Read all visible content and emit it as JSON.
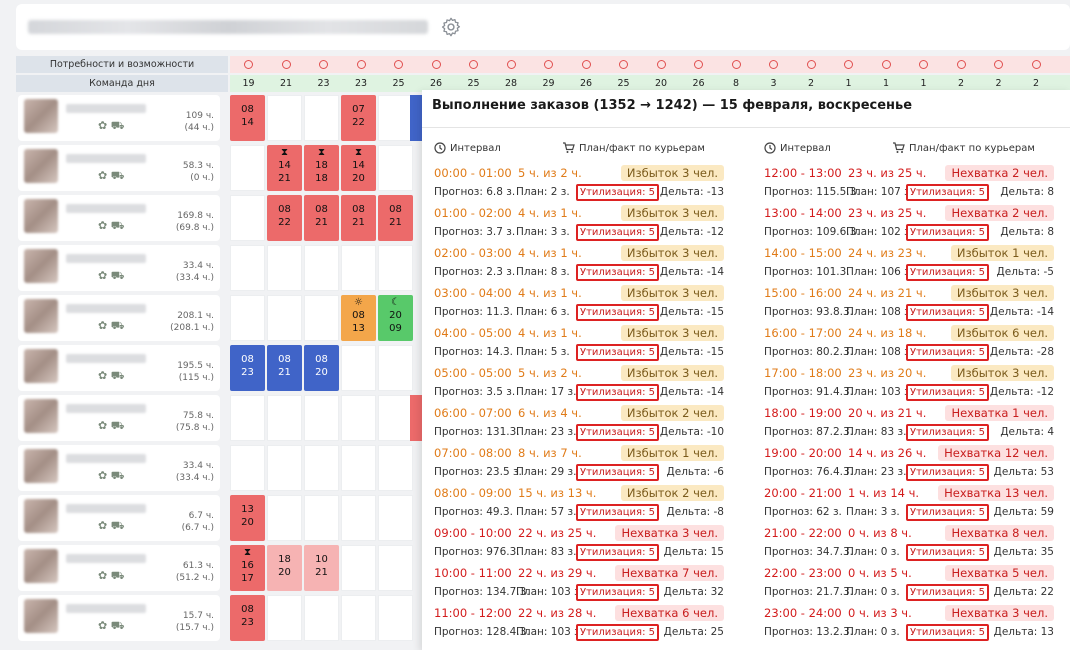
{
  "header": {
    "settings_icon": "gear-icon"
  },
  "grid": {
    "needs_label": "Потребности и возможности",
    "team_label": "Команда дня",
    "day_counts": [
      "19",
      "21",
      "23",
      "23",
      "25",
      "26",
      "25",
      "28",
      "29",
      "26",
      "25",
      "20",
      "26",
      "8",
      "3",
      "2",
      "1",
      "1",
      "1",
      "2",
      "2",
      "2"
    ],
    "hours": [
      {
        "total": "109 ч.",
        "sub": "(44 ч.)"
      },
      {
        "total": "58.3 ч.",
        "sub": "(0 ч.)"
      },
      {
        "total": "169.8 ч.",
        "sub": "(69.8 ч.)"
      },
      {
        "total": "33.4 ч.",
        "sub": "(33.4 ч.)"
      },
      {
        "total": "208.1 ч.",
        "sub": "(208.1 ч.)"
      },
      {
        "total": "195.5 ч.",
        "sub": "(115 ч.)"
      },
      {
        "total": "75.8 ч.",
        "sub": "(75.8 ч.)"
      },
      {
        "total": "33.4 ч.",
        "sub": "(33.4 ч.)"
      },
      {
        "total": "6.7 ч.",
        "sub": "(6.7 ч.)"
      },
      {
        "total": "61.3 ч.",
        "sub": "(51.2 ч.)"
      },
      {
        "total": "15.7 ч.",
        "sub": "(15.7 ч.)"
      }
    ],
    "shifts": [
      [
        {
          "col": 0,
          "a": "08",
          "b": "14",
          "c": "red"
        },
        {
          "col": 3,
          "a": "07",
          "b": "22",
          "c": "red"
        }
      ],
      [
        {
          "col": 1,
          "a": "14",
          "b": "21",
          "c": "red",
          "i": "⧗"
        },
        {
          "col": 2,
          "a": "18",
          "b": "18",
          "c": "red",
          "i": "⧗"
        },
        {
          "col": 3,
          "a": "14",
          "b": "20",
          "c": "red",
          "i": "⧗"
        }
      ],
      [
        {
          "col": 1,
          "a": "08",
          "b": "22",
          "c": "red"
        },
        {
          "col": 2,
          "a": "08",
          "b": "21",
          "c": "red"
        },
        {
          "col": 3,
          "a": "08",
          "b": "21",
          "c": "red"
        },
        {
          "col": 4,
          "a": "08",
          "b": "21",
          "c": "red"
        }
      ],
      [],
      [
        {
          "col": 3,
          "a": "08",
          "b": "13",
          "c": "orange",
          "i": "☼"
        },
        {
          "col": 4,
          "a": "20",
          "b": "09",
          "c": "green",
          "i": "☾"
        }
      ],
      [
        {
          "col": 0,
          "a": "08",
          "b": "23",
          "c": "blue"
        },
        {
          "col": 1,
          "a": "08",
          "b": "21",
          "c": "blue"
        },
        {
          "col": 2,
          "a": "08",
          "b": "20",
          "c": "blue"
        }
      ],
      [],
      [],
      [
        {
          "col": 0,
          "a": "13",
          "b": "20",
          "c": "red"
        }
      ],
      [
        {
          "col": 0,
          "a": "16",
          "b": "17",
          "c": "red",
          "i": "⧗"
        },
        {
          "col": 1,
          "a": "18",
          "b": "20",
          "c": "pink"
        },
        {
          "col": 2,
          "a": "10",
          "b": "21",
          "c": "pink"
        }
      ],
      [
        {
          "col": 0,
          "a": "08",
          "b": "23",
          "c": "red"
        }
      ]
    ]
  },
  "popup": {
    "title": "Выполнение заказов (1352 → 1242) — 15 февраля, воскресенье",
    "interval_label": "Интервал",
    "planfact_label": "План/факт по курьерам",
    "left": [
      {
        "iv": "00:00 - 01:00",
        "hr": "5 ч. из 2 ч.",
        "st": "Избыток 3 чел.",
        "sc": "surplus",
        "fc": "Прогноз: 6.8 з.",
        "pl": "План: 2 з.",
        "ut": "Утилизация: 5",
        "dl": "Дельта: -13"
      },
      {
        "iv": "01:00 - 02:00",
        "hr": "4 ч. из 1 ч.",
        "st": "Избыток 3 чел.",
        "sc": "surplus",
        "fc": "Прогноз: 3.7 з.",
        "pl": "План: 3 з.",
        "ut": "Утилизация: 5",
        "dl": "Дельта: -12"
      },
      {
        "iv": "02:00 - 03:00",
        "hr": "4 ч. из 1 ч.",
        "st": "Избыток 3 чел.",
        "sc": "surplus",
        "fc": "Прогноз: 2.3 з.",
        "pl": "План: 8 з.",
        "ut": "Утилизация: 5",
        "dl": "Дельта: -14"
      },
      {
        "iv": "03:00 - 04:00",
        "hr": "4 ч. из 1 ч.",
        "st": "Избыток 3 чел.",
        "sc": "surplus",
        "fc": "Прогноз: 11.3.",
        "pl": "План: 6 з.",
        "ut": "Утилизация: 5",
        "dl": "Дельта: -15"
      },
      {
        "iv": "04:00 - 05:00",
        "hr": "4 ч. из 1 ч.",
        "st": "Избыток 3 чел.",
        "sc": "surplus",
        "fc": "Прогноз: 14.3.",
        "pl": "План: 5 з.",
        "ut": "Утилизация: 5",
        "dl": "Дельта: -15"
      },
      {
        "iv": "05:00 - 05:00",
        "hr": "5 ч. из 2 ч.",
        "st": "Избыток 3 чел.",
        "sc": "surplus",
        "fc": "Прогноз: 3.5 з.",
        "pl": "План: 17 з.",
        "ut": "Утилизация: 5",
        "dl": "Дельта: -14"
      },
      {
        "iv": "06:00 - 07:00",
        "hr": "6 ч. из 4 ч.",
        "st": "Избыток 2 чел.",
        "sc": "surplus",
        "fc": "Прогноз: 131.3.",
        "pl": "План: 23 з.",
        "ut": "Утилизация: 5",
        "dl": "Дельта: -10"
      },
      {
        "iv": "07:00 - 08:00",
        "hr": "8 ч. из 7 ч.",
        "st": "Избыток 1 чел.",
        "sc": "surplus",
        "fc": "Прогноз: 23.5 з.",
        "pl": "План: 29 з.",
        "ut": "Утилизация: 5",
        "dl": "Дельта: -6"
      },
      {
        "iv": "08:00 - 09:00",
        "hr": "15 ч. из 13 ч.",
        "st": "Избыток 2 чел.",
        "sc": "surplus",
        "fc": "Прогноз: 49.3.",
        "pl": "План: 57 з.",
        "ut": "Утилизация: 5",
        "dl": "Дельта: -8"
      },
      {
        "iv": "09:00 - 10:00",
        "hr": "22 ч. из 25 ч.",
        "st": "Нехватка 3 чел.",
        "sc": "lack",
        "fc": "Прогноз: 976.3.",
        "pl": "План: 83 з.",
        "ut": "Утилизация: 5",
        "dl": "Дельта: 15"
      },
      {
        "iv": "10:00 - 11:00",
        "hr": "22 ч. из 29 ч.",
        "st": "Нехватка 7 чел.",
        "sc": "lack",
        "fc": "Прогноз: 134.7.3.",
        "pl": "План: 103 з.",
        "ut": "Утилизация: 5",
        "dl": "Дельта: 32"
      },
      {
        "iv": "11:00 - 12:00",
        "hr": "22 ч. из 28 ч.",
        "st": "Нехватка 6 чел.",
        "sc": "lack",
        "fc": "Прогноз: 128.4.3.",
        "pl": "План: 103 з.",
        "ut": "Утилизация: 5",
        "dl": "Дельта: 25"
      }
    ],
    "right": [
      {
        "iv": "12:00 - 13:00",
        "hr": "23 ч. из 25 ч.",
        "st": "Нехватка 2 чел.",
        "sc": "lack",
        "fc": "Прогноз: 115.5.3.",
        "pl": "План: 107 з.",
        "ut": "Утилизация: 5",
        "dl": "Дельта: 8"
      },
      {
        "iv": "13:00 - 14:00",
        "hr": "23 ч. из 25 ч.",
        "st": "Нехватка 2 чел.",
        "sc": "lack",
        "fc": "Прогноз: 109.6.3.",
        "pl": "План: 102 з.",
        "ut": "Утилизация: 5",
        "dl": "Дельта: 8"
      },
      {
        "iv": "14:00 - 15:00",
        "hr": "24 ч. из 23 ч.",
        "st": "Избыток 1 чел.",
        "sc": "surplus",
        "fc": "Прогноз: 101.3.",
        "pl": "План: 106 з.",
        "ut": "Утилизация: 5",
        "dl": "Дельта: -5"
      },
      {
        "iv": "15:00 - 16:00",
        "hr": "24 ч. из 21 ч.",
        "st": "Избыток 3 чел.",
        "sc": "surplus",
        "fc": "Прогноз: 93.8.3.",
        "pl": "План: 108 з.",
        "ut": "Утилизация: 5",
        "dl": "Дельта: -14"
      },
      {
        "iv": "16:00 - 17:00",
        "hr": "24 ч. из 18 ч.",
        "st": "Избыток 6 чел.",
        "sc": "surplus",
        "fc": "Прогноз: 80.2.3.",
        "pl": "План: 108 з.",
        "ut": "Утилизация: 5",
        "dl": "Дельта: -28"
      },
      {
        "iv": "17:00 - 18:00",
        "hr": "23 ч. из 20 ч.",
        "st": "Избыток 3 чел.",
        "sc": "surplus",
        "fc": "Прогноз: 91.4.3.",
        "pl": "План: 103 з.",
        "ut": "Утилизация: 5",
        "dl": "Дельта: -12"
      },
      {
        "iv": "18:00 - 19:00",
        "hr": "20 ч. из 21 ч.",
        "st": "Нехватка 1 чел.",
        "sc": "lack",
        "fc": "Прогноз: 87.2.3.",
        "pl": "План: 83 з.",
        "ut": "Утилизация: 5",
        "dl": "Дельта: 4"
      },
      {
        "iv": "19:00 - 20:00",
        "hr": "14 ч. из 26 ч.",
        "st": "Нехватка 12 чел.",
        "sc": "lack",
        "fc": "Прогноз: 76.4.3.",
        "pl": "План: 23 з.",
        "ut": "Утилизация: 5",
        "dl": "Дельта: 53"
      },
      {
        "iv": "20:00 - 21:00",
        "hr": "1 ч. из 14 ч.",
        "st": "Нехватка 13 чел.",
        "sc": "lack",
        "fc": "Прогноз: 62 з.",
        "pl": "План: 3 з.",
        "ut": "Утилизация: 5",
        "dl": "Дельта: 59"
      },
      {
        "iv": "21:00 - 22:00",
        "hr": "0 ч. из 8 ч.",
        "st": "Нехватка 8 чел.",
        "sc": "lack",
        "fc": "Прогноз: 34.7.3.",
        "pl": "План: 0 з.",
        "ut": "Утилизация: 5",
        "dl": "Дельта: 35"
      },
      {
        "iv": "22:00 - 23:00",
        "hr": "0 ч. из 5 ч.",
        "st": "Нехватка 5 чел.",
        "sc": "lack",
        "fc": "Прогноз: 21.7.3.",
        "pl": "План: 0 з.",
        "ut": "Утилизация: 5",
        "dl": "Дельта: 22"
      },
      {
        "iv": "23:00 - 24:00",
        "hr": "0 ч. из 3 ч.",
        "st": "Нехватка 3 чел.",
        "sc": "lack",
        "fc": "Прогноз: 13.2.3.",
        "pl": "План: 0 з.",
        "ut": "Утилизация: 5",
        "dl": "Дельта: 13"
      }
    ]
  }
}
